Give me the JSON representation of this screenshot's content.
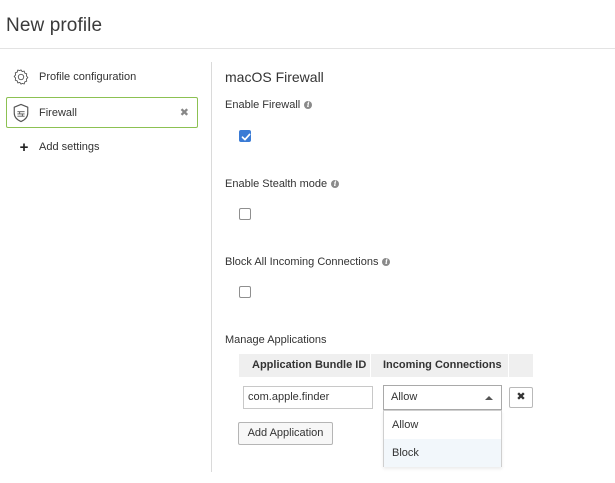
{
  "page": {
    "title": "New profile"
  },
  "sidebar": {
    "items": [
      {
        "label": "Profile configuration",
        "icon": "gear-icon"
      },
      {
        "label": "Firewall",
        "icon": "firewall-shield-icon",
        "selected": true,
        "close_glyph": "✖"
      },
      {
        "label": "Add settings",
        "icon": "plus-icon",
        "glyph": "+"
      }
    ]
  },
  "main": {
    "section_title": "macOS Firewall",
    "enable_firewall": {
      "label": "Enable Firewall",
      "checked": true
    },
    "stealth_mode": {
      "label": "Enable Stealth mode",
      "checked": false
    },
    "block_incoming": {
      "label": "Block All Incoming Connections",
      "checked": false
    },
    "manage_apps": {
      "label": "Manage Applications",
      "columns": [
        "Application Bundle ID",
        "Incoming Connections"
      ],
      "rows": [
        {
          "bundle_id": "com.apple.finder",
          "incoming": "Allow"
        }
      ],
      "delete_glyph": "✖",
      "dropdown_options": [
        "Allow",
        "Block"
      ],
      "add_button": "Add Application"
    }
  },
  "colors": {
    "accent_green": "#8cc152",
    "checkbox_blue": "#3a7bd5"
  }
}
